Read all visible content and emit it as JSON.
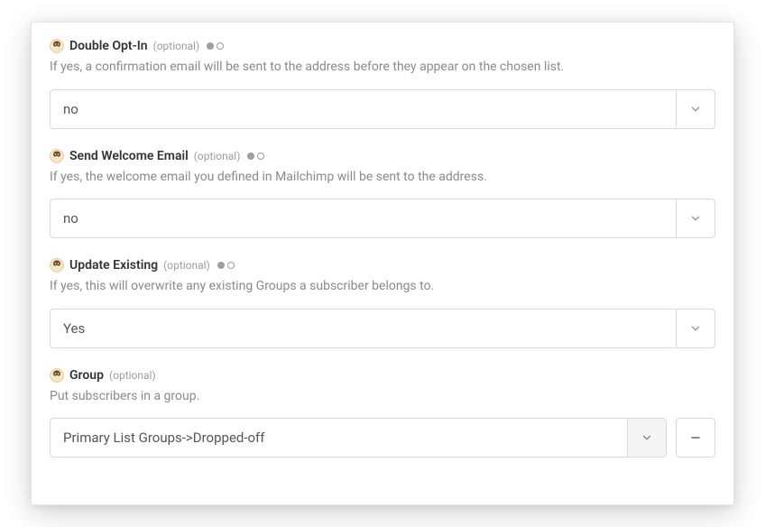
{
  "fields": {
    "doubleOptIn": {
      "label": "Double Opt-In",
      "optional": "(optional)",
      "help": "If yes, a confirmation email will be sent to the address before they appear on the chosen list.",
      "value": "no"
    },
    "sendWelcome": {
      "label": "Send Welcome Email",
      "optional": "(optional)",
      "help": "If yes, the welcome email you defined in Mailchimp will be sent to the address.",
      "value": "no"
    },
    "updateExisting": {
      "label": "Update Existing",
      "optional": "(optional)",
      "help": "If yes, this will overwrite any existing Groups a subscriber belongs to.",
      "value": "Yes"
    },
    "group": {
      "label": "Group",
      "optional": "(optional)",
      "help": "Put subscribers in a group.",
      "value": "Primary List Groups->Dropped-off"
    }
  }
}
